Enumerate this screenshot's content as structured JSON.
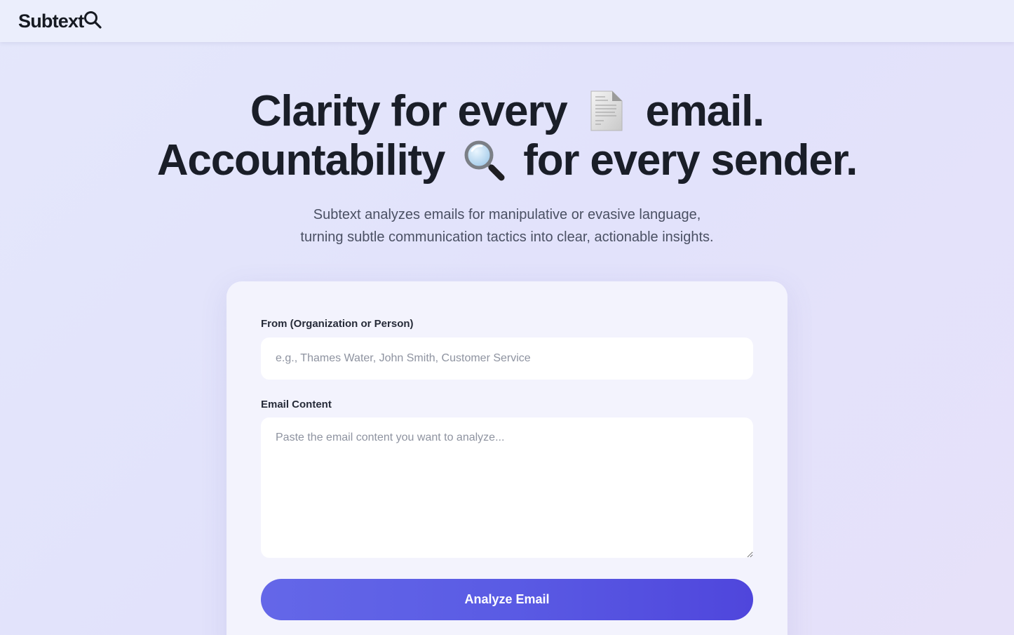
{
  "header": {
    "logo_text": "Subtext",
    "logo_icon": "magnifier-icon"
  },
  "hero": {
    "line1_part1": "Clarity for every",
    "line1_icon": "document-icon",
    "line1_part2": "email.",
    "line2_part1": "Accountability",
    "line2_icon": "magnifying-glass-icon",
    "line2_part2": "for every sender.",
    "subtitle_line1": "Subtext analyzes emails for manipulative or evasive language,",
    "subtitle_line2": "turning subtle communication tactics into clear, actionable insights."
  },
  "form": {
    "from_label": "From (Organization or Person)",
    "from_placeholder": "e.g., Thames Water, John Smith, Customer Service",
    "from_value": "",
    "content_label": "Email Content",
    "content_placeholder": "Paste the email content you want to analyze...",
    "content_value": "",
    "submit_label": "Analyze Email"
  },
  "colors": {
    "accent": "#5a5be4",
    "text_dark": "#1a1e28",
    "text_muted": "#4a5063"
  }
}
